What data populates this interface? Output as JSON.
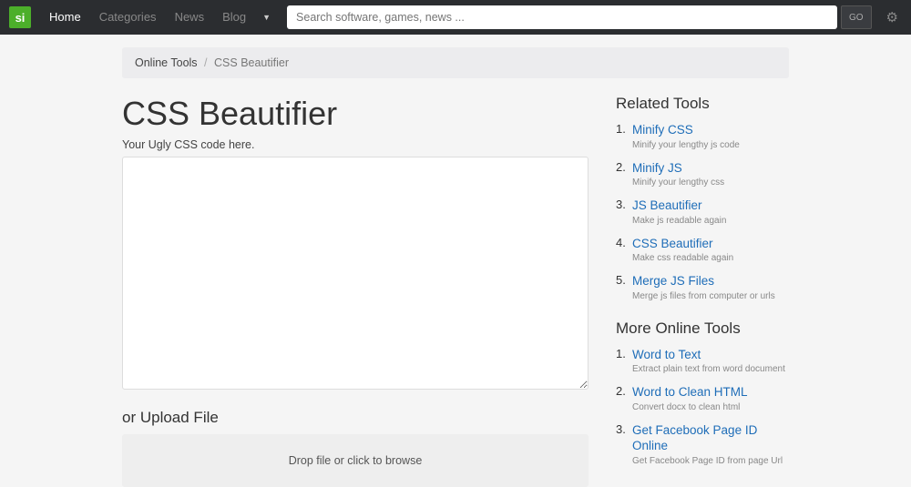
{
  "nav": {
    "logo": "si",
    "links": [
      "Home",
      "Categories",
      "News",
      "Blog"
    ],
    "search_placeholder": "Search software, games, news ...",
    "go_label": "GO"
  },
  "breadcrumb": {
    "parent": "Online Tools",
    "current": "CSS Beautifier"
  },
  "main": {
    "title": "CSS Beautifier",
    "textarea_label": "Your Ugly CSS code here.",
    "upload_heading": "or Upload File",
    "dropzone_text": "Drop file or click to browse"
  },
  "sidebar": {
    "related_heading": "Related Tools",
    "related": [
      {
        "title": "Minify CSS",
        "desc": "Minify your lengthy js code"
      },
      {
        "title": "Minify JS",
        "desc": "Minify your lengthy css"
      },
      {
        "title": "JS Beautifier",
        "desc": "Make js readable again"
      },
      {
        "title": "CSS Beautifier",
        "desc": "Make css readable again"
      },
      {
        "title": "Merge JS Files",
        "desc": "Merge js files from computer or urls"
      }
    ],
    "more_heading": "More Online Tools",
    "more": [
      {
        "title": "Word to Text",
        "desc": "Extract plain text from word document"
      },
      {
        "title": "Word to Clean HTML",
        "desc": "Convert docx to clean html"
      },
      {
        "title": "Get Facebook Page ID Online",
        "desc": "Get Facebook Page ID from page Url"
      }
    ]
  }
}
